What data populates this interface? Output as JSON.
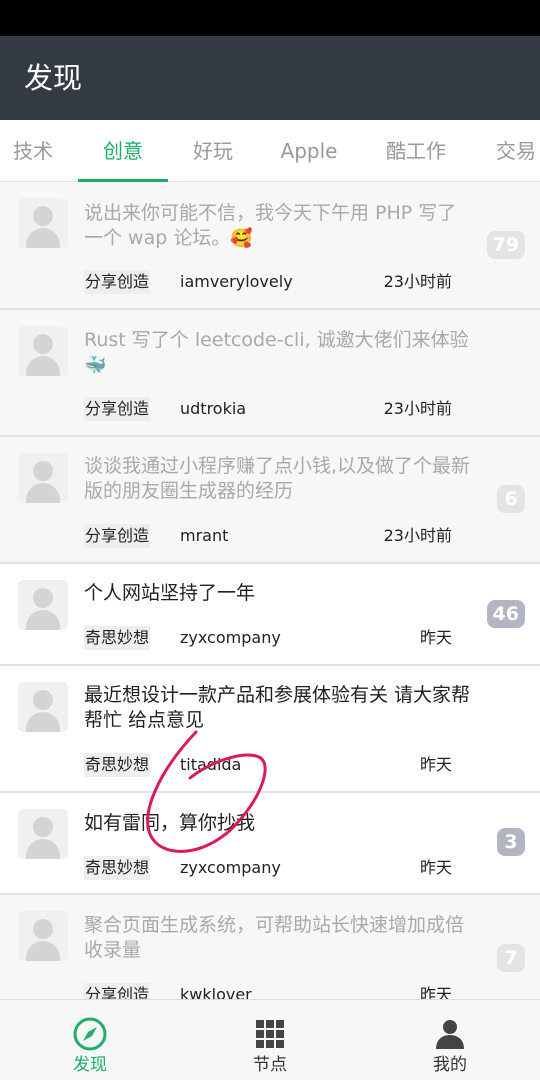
{
  "app": {
    "title": "发现"
  },
  "tabs": [
    {
      "label": "技术"
    },
    {
      "label": "创意"
    },
    {
      "label": "好玩"
    },
    {
      "label": "Apple"
    },
    {
      "label": "酷工作"
    },
    {
      "label": "交易"
    }
  ],
  "topics": [
    {
      "title": "说出来你可能不信，我今天下午用 PHP 写了一个 wap 论坛。",
      "emoji": "🥰",
      "node": "分享创造",
      "user": "iamverylovely",
      "time": "23小时前",
      "replies": "79",
      "read": true
    },
    {
      "title": "Rust 写了个 leetcode-cli, 诚邀大佬们来体验",
      "emoji": "🐳",
      "node": "分享创造",
      "user": "udtrokia",
      "time": "23小时前",
      "replies": "",
      "read": true
    },
    {
      "title": "谈谈我通过小程序赚了点小钱,以及做了个最新版的朋友圈生成器的经历",
      "emoji": "",
      "node": "分享创造",
      "user": "mrant",
      "time": "23小时前",
      "replies": "6",
      "read": true
    },
    {
      "title": "个人网站坚持了一年",
      "emoji": "",
      "node": "奇思妙想",
      "user": "zyxcompany",
      "time": "昨天",
      "replies": "46",
      "read": false
    },
    {
      "title": "最近想设计一款产品和参展体验有关 请大家帮帮忙 给点意见",
      "emoji": "",
      "node": "奇思妙想",
      "user": "titadida",
      "time": "昨天",
      "replies": "",
      "read": false
    },
    {
      "title": "如有雷同，算你抄我",
      "emoji": "",
      "node": "奇思妙想",
      "user": "zyxcompany",
      "time": "昨天",
      "replies": "3",
      "read": false
    },
    {
      "title": "聚合页面生成系统，可帮助站长快速增加成倍收录量",
      "emoji": "",
      "node": "分享创造",
      "user": "kwklover",
      "time": "昨天",
      "replies": "7",
      "read": true
    }
  ],
  "bottom_nav": [
    {
      "label": "发现",
      "icon": "compass-icon"
    },
    {
      "label": "节点",
      "icon": "grid-icon"
    },
    {
      "label": "我的",
      "icon": "person-icon"
    }
  ],
  "colors": {
    "accent": "#1fae6a",
    "app_bar": "#353b44",
    "annotation": "#d81b60"
  }
}
